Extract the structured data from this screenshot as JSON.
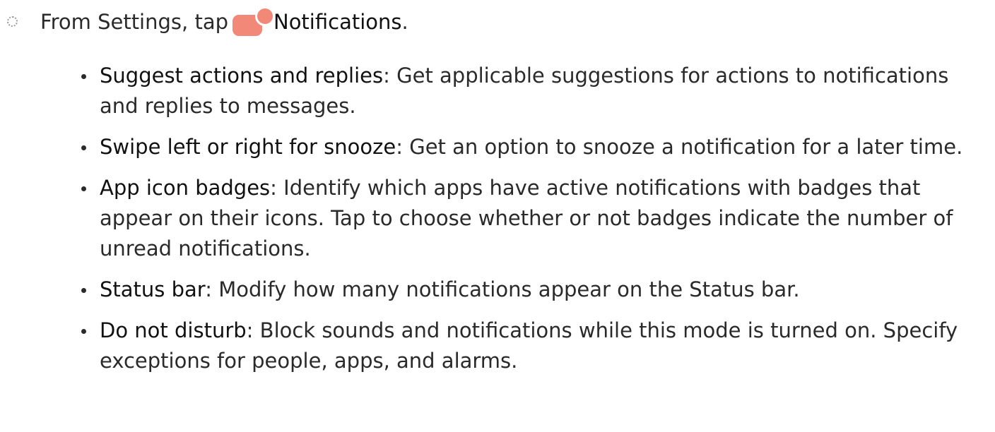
{
  "step": {
    "prefix": "From Settings, tap",
    "link": "Notifications",
    "suffix": ".",
    "icon": "notifications-settings-icon",
    "icon_color": "#f18878"
  },
  "options": [
    {
      "name": "Suggest actions and replies",
      "separator": ":",
      "description": " Get applicable suggestions for actions to notifications and replies to messages."
    },
    {
      "name": "Swipe left or right for snooze",
      "separator": ":",
      "description": " Get an option to snooze a notification for a later time."
    },
    {
      "name": "App icon badges",
      "separator": ":",
      "description": " Identify which apps have active notifications with badges that appear on their icons. Tap to choose whether or not badges indicate the number of unread notifications."
    },
    {
      "name": "Status bar",
      "separator": ":",
      "description": " Modify how many notifications appear on the Status bar."
    },
    {
      "name": "Do not disturb",
      "separator": ":",
      "description": " Block sounds and notifications while this mode is turned on. Specify exceptions for people, apps, and alarms."
    }
  ]
}
